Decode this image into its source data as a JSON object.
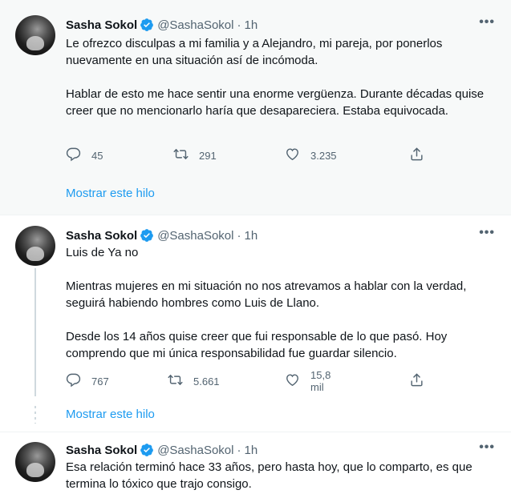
{
  "tweets": [
    {
      "name": "Sasha Sokol",
      "handle": "@SashaSokol",
      "separator": "·",
      "time": "1h",
      "paragraphs": [
        "Le ofrezco disculpas a mi familia y a Alejandro, mi pareja, por ponerlos nuevamente en una situación así de incómoda.",
        "Hablar de esto me hace sentir una enorme vergüenza. Durante décadas quise creer que no mencionarlo haría que desapareciera. Estaba equivocada."
      ],
      "replies": "45",
      "retweets": "291",
      "likes": "3.235",
      "show_thread": "Mostrar este hilo"
    },
    {
      "name": "Sasha Sokol",
      "handle": "@SashaSokol",
      "separator": "·",
      "time": "1h",
      "paragraphs": [
        "Luis de Ya no",
        "Mientras mujeres en mi situación no nos atrevamos a hablar con la verdad, seguirá habiendo hombres como Luis de Llano.",
        "Desde los 14 años quise creer que fui responsable de lo que pasó. Hoy comprendo que mi única responsabilidad fue guardar silencio."
      ],
      "replies": "767",
      "retweets": "5.661",
      "likes": "15,8 mil",
      "show_thread": "Mostrar este hilo"
    },
    {
      "name": "Sasha Sokol",
      "handle": "@SashaSokol",
      "separator": "·",
      "time": "1h",
      "paragraphs": [
        "Esa relación terminó hace 33 años, pero hasta hoy, que lo comparto, es que termina lo tóxico que trajo consigo."
      ]
    }
  ],
  "more_label": "•••",
  "icons": {
    "verified": "verified-badge-icon",
    "reply": "reply-icon",
    "retweet": "retweet-icon",
    "like": "heart-icon",
    "share": "share-icon",
    "more": "more-options-icon"
  },
  "colors": {
    "accent": "#1d9bf0",
    "secondary_text": "#536471",
    "highlight_bg": "#f7f9f9"
  }
}
